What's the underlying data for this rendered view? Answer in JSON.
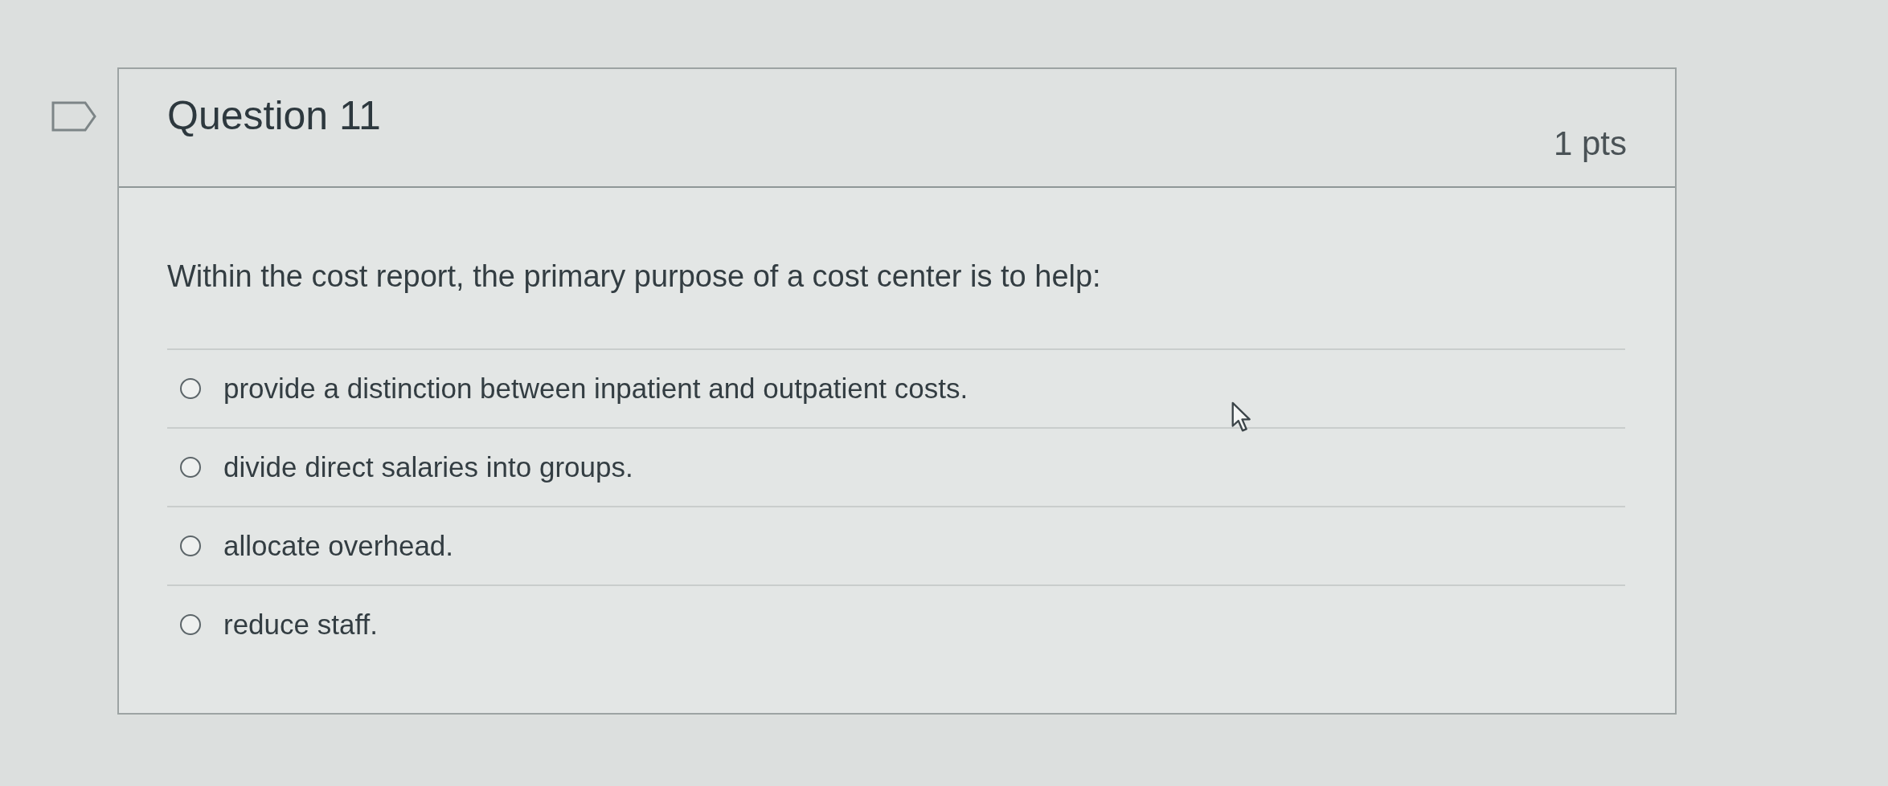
{
  "question": {
    "flagged": false,
    "title": "Question 11",
    "points": "1 pts",
    "text": "Within the cost report, the primary purpose of a cost center is to help:",
    "answers": [
      {
        "label": "provide a distinction between inpatient and outpatient costs.",
        "selected": false
      },
      {
        "label": "divide direct salaries into groups.",
        "selected": false
      },
      {
        "label": "allocate overhead.",
        "selected": false
      },
      {
        "label": "reduce staff.",
        "selected": false
      }
    ]
  }
}
